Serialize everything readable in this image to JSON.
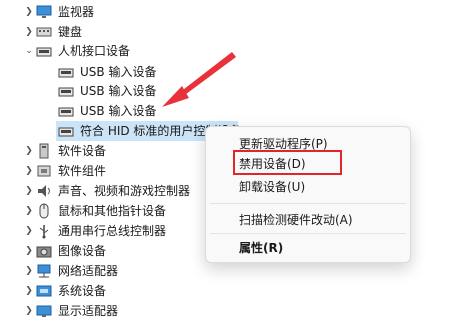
{
  "tree": {
    "monitor": "监视器",
    "keyboard": "键盘",
    "hid": "人机接口设备",
    "hid_items": [
      "USB 输入设备",
      "USB 输入设备",
      "USB 输入设备",
      "符合 HID 标准的用户控制设备"
    ],
    "categories": [
      "软件设备",
      "软件组件",
      "声音、视频和游戏控制器",
      "鼠标和其他指针设备",
      "通用串行总线控制器",
      "图像设备",
      "网络适配器",
      "系统设备",
      "显示适配器"
    ]
  },
  "context_menu": {
    "update_driver": "更新驱动程序(P)",
    "disable_device": "禁用设备(D)",
    "uninstall_device": "卸载设备(U)",
    "scan_hardware": "扫描检测硬件改动(A)",
    "properties": "属性(R)"
  },
  "colors": {
    "selection": "#cce4f7",
    "highlight_box": "#e0252b",
    "arrow": "#e8323b"
  }
}
